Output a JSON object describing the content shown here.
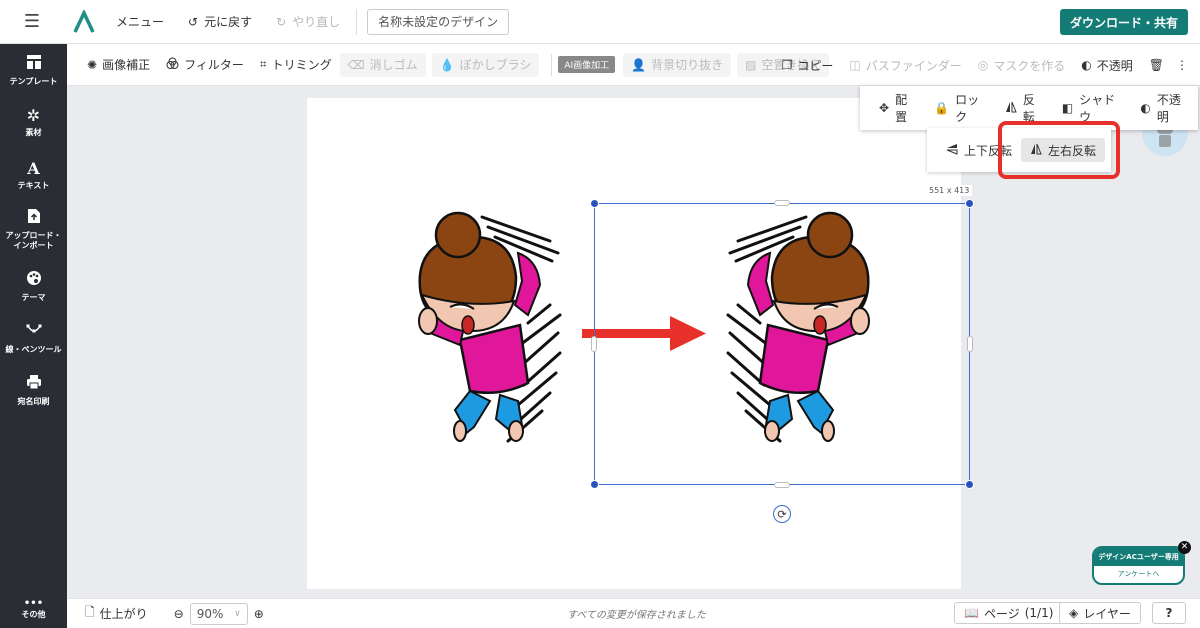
{
  "topbar": {
    "menu_label": "メニュー",
    "undo_label": "元に戻す",
    "redo_label": "やり直し",
    "design_name": "名称未設定のデザイン",
    "download_label": "ダウンロード・共有"
  },
  "sidebar": {
    "items": [
      {
        "label": "テンプレート",
        "icon": "template-icon"
      },
      {
        "label": "素材",
        "icon": "material-icon"
      },
      {
        "label": "テキスト",
        "icon": "text-icon"
      },
      {
        "label_line1": "アップロード・",
        "label_line2": "インポート",
        "icon": "upload-icon"
      },
      {
        "label": "テーマ",
        "icon": "palette-icon"
      },
      {
        "label": "線・ペンツール",
        "icon": "pen-tool-icon"
      },
      {
        "label": "宛名印刷",
        "icon": "printer-icon"
      },
      {
        "label": "その他",
        "icon": "more-icon"
      }
    ]
  },
  "toolbar": {
    "image_correction": "画像補正",
    "filter": "フィルター",
    "trimming": "トリミング",
    "eraser": "消しゴム",
    "blur_brush": "ぼかしブラシ",
    "ai_badge": "AI画像加工",
    "bg_remove": "背景切り抜き",
    "sky_replace": "空置き換え",
    "copy": "コピー",
    "pathfinder": "パスファインダー",
    "make_mask": "マスクを作る",
    "opacity": "不透明"
  },
  "menu_primary": {
    "arrange": "配置",
    "lock": "ロック",
    "flip": "反転",
    "shadow": "シャドウ",
    "opacity": "不透明"
  },
  "menu_flip": {
    "vertical": "上下反転",
    "horizontal": "左右反転"
  },
  "canvas": {
    "size_label": "551 x 413"
  },
  "bottombar": {
    "finish": "仕上がり",
    "zoom": "90%",
    "saved_message": "すべての変更が保存されました",
    "page_label": "ページ",
    "page_count": "(1/1)",
    "layer_label": "レイヤー",
    "help": "?"
  },
  "survey": {
    "title": "デザインACユーザー専用",
    "link": "アンケートへ"
  },
  "colors": {
    "brand": "#147b76",
    "sidebar_bg": "#2a2d33",
    "selection": "#3b6fd1",
    "highlight": "#e8302a",
    "arrow": "#e8302a"
  }
}
